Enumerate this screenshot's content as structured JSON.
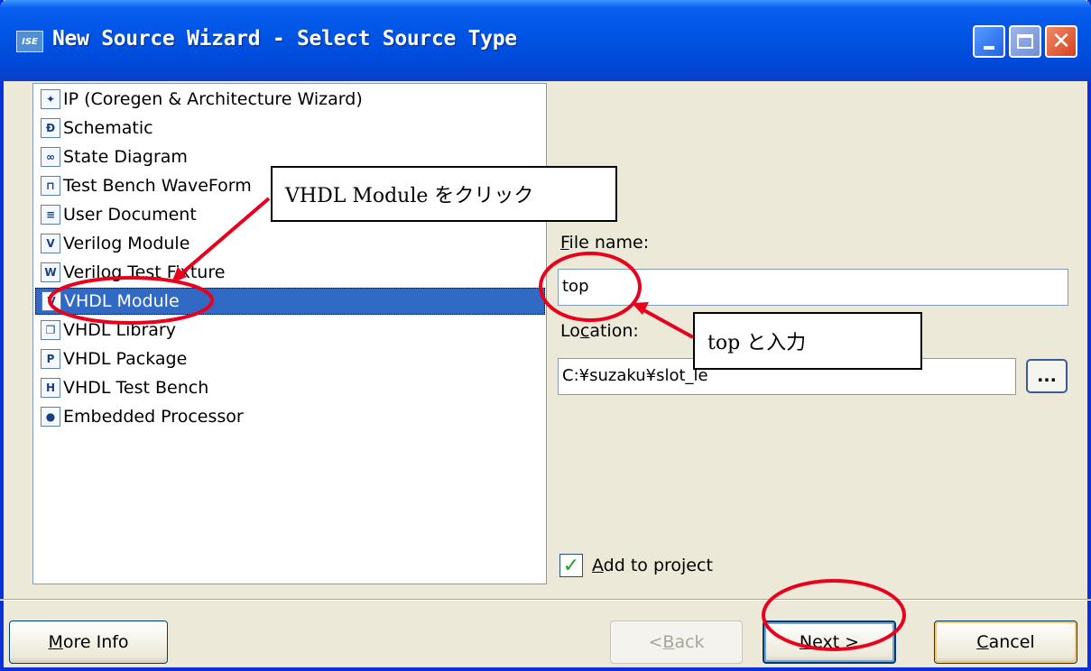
{
  "window": {
    "title": "New Source Wizard - Select Source Type",
    "app_icon_label": "ISE"
  },
  "source_types": [
    {
      "label": "IP (Coregen & Architecture Wizard)",
      "icon": "ip-core-icon",
      "glyph": "✦"
    },
    {
      "label": "Schematic",
      "icon": "schematic-icon",
      "glyph": "Ð"
    },
    {
      "label": "State Diagram",
      "icon": "state-diagram-icon",
      "glyph": "∞"
    },
    {
      "label": "Test Bench WaveForm",
      "icon": "waveform-icon",
      "glyph": "⊓"
    },
    {
      "label": "User Document",
      "icon": "document-icon",
      "glyph": "≡"
    },
    {
      "label": "Verilog Module",
      "icon": "verilog-module-icon",
      "glyph": "V"
    },
    {
      "label": "Verilog Test Fixture",
      "icon": "verilog-fixture-icon",
      "glyph": "W"
    },
    {
      "label": "VHDL Module",
      "icon": "vhdl-module-icon",
      "glyph": "V",
      "selected": true
    },
    {
      "label": "VHDL Library",
      "icon": "library-icon",
      "glyph": "❐"
    },
    {
      "label": "VHDL Package",
      "icon": "package-icon",
      "glyph": "P"
    },
    {
      "label": "VHDL Test Bench",
      "icon": "testbench-icon",
      "glyph": "H"
    },
    {
      "label": "Embedded Processor",
      "icon": "processor-icon",
      "glyph": "●"
    }
  ],
  "file_name": {
    "label_prefix": "",
    "label_key": "F",
    "label_rest": "ile name:",
    "value": "top"
  },
  "location": {
    "label_pre": "Lo",
    "label_key": "c",
    "label_rest": "ation:",
    "value": "C:¥suzaku¥slot_le",
    "browse_label": "..."
  },
  "add_to_project": {
    "key": "A",
    "rest": "dd to project",
    "checked": true
  },
  "buttons": {
    "more_info": {
      "key": "M",
      "rest": "ore Info"
    },
    "back": {
      "pre": "< ",
      "key": "B",
      "rest": "ack"
    },
    "next": {
      "key": "N",
      "rest": "ext >"
    },
    "cancel": {
      "key": "C",
      "rest": "ancel"
    }
  },
  "annotations": {
    "callout_vhdl": "VHDL Module をクリック",
    "callout_top": "top と入力"
  },
  "colors": {
    "highlight": "#e8001c",
    "selection": "#316ac5"
  }
}
